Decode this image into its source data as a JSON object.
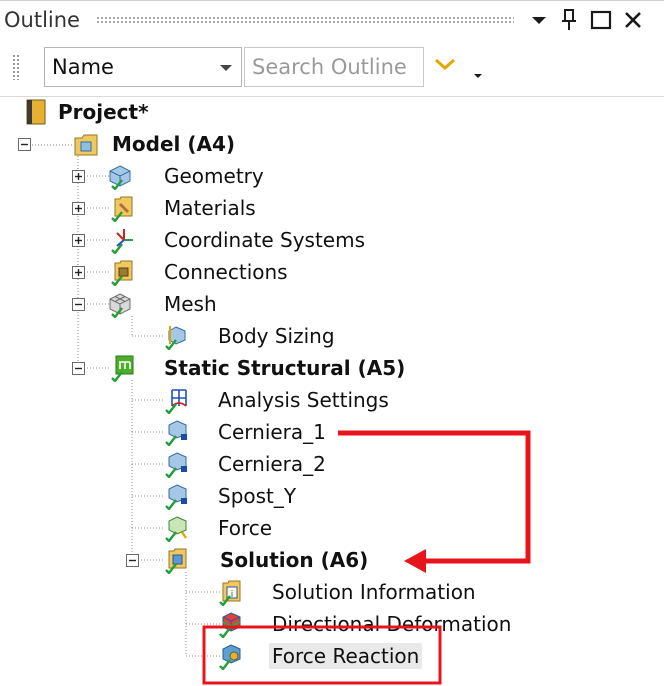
{
  "panel": {
    "title": "Outline",
    "buttons": [
      "dropdown-arrow-icon",
      "pin-icon",
      "maximize-icon",
      "close-icon"
    ]
  },
  "toolbar": {
    "sort_select": "Name",
    "search_placeholder": "Search Outline",
    "filter_icon": "chevron-down-icon"
  },
  "tree": {
    "project": "Project*",
    "model": "Model (A4)",
    "geometry": "Geometry",
    "materials": "Materials",
    "coordinate_systems": "Coordinate Systems",
    "connections": "Connections",
    "mesh": "Mesh",
    "body_sizing": "Body Sizing",
    "static_structural": "Static Structural (A5)",
    "analysis_settings": "Analysis Settings",
    "cerniera_1": "Cerniera_1",
    "cerniera_2": "Cerniera_2",
    "spost_y": "Spost_Y",
    "force": "Force",
    "solution": "Solution (A6)",
    "solution_information": "Solution Information",
    "directional_deformation": "Directional Deformation",
    "force_reaction": "Force Reaction"
  },
  "annotation": {
    "arrow_color": "#e8141c",
    "highlight_box_color": "#e8141c"
  }
}
